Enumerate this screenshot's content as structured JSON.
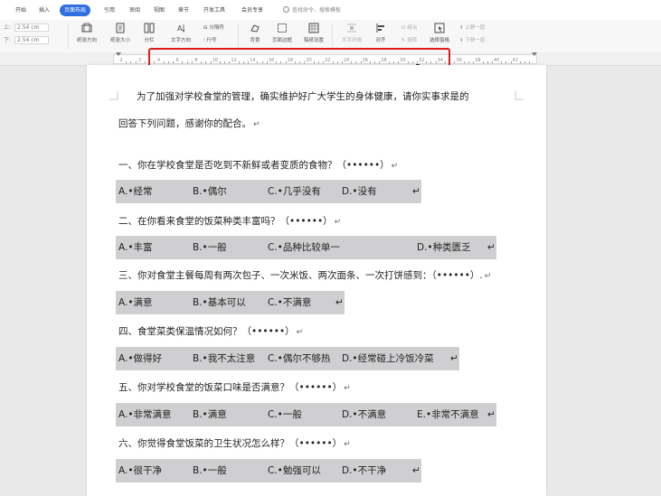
{
  "tabs": {
    "start": "开始",
    "insert": "插入",
    "page_layout": "页面布局",
    "references": "引用",
    "review": "审阅",
    "view": "视图",
    "sections": "章节",
    "developer": "开发工具",
    "member": "会员专享",
    "search_placeholder": "查找命令、搜索模板"
  },
  "ribbon": {
    "margin_top_label": "上:",
    "margin_top_value": "2.54 cm",
    "margin_bottom_label": "下:",
    "margin_bottom_value": "2.54 cm",
    "margin_left_label": "左:",
    "margin_left_value": "3.18 cm",
    "margin_right_label": "右:",
    "margin_right_value": "3.18 cm",
    "orientation": "纸张方向",
    "size": "纸张大小",
    "columns": "分栏",
    "text_direction": "文字方向",
    "line_numbers": "行号",
    "breaks": "分隔符",
    "background": "背景",
    "page_border": "页面边框",
    "draft_paper": "稿纸设置",
    "text_wrap": "文字环绕",
    "align": "对齐",
    "rotate": "旋转",
    "group": "组合",
    "selection_pane": "选择窗格",
    "bring_forward": "上移一层",
    "send_backward": "下移一层"
  },
  "ruler": {
    "numbers": [
      "2",
      "2",
      "4",
      "6",
      "8",
      "10",
      "12",
      "14",
      "16",
      "18",
      "20",
      "22",
      "24",
      "26",
      "28",
      "30",
      "32",
      "34",
      "36",
      "38",
      "40",
      "42"
    ]
  },
  "document": {
    "intro_line1": "为了加强对学校食堂的管理，确实维护好广大学生的身体健康，请你实事求是的",
    "intro_line2": "回答下列问题，感谢你的配合。",
    "paragraph_mark": "↵",
    "questions": [
      {
        "text": "一、你在学校食堂是否吃到不新鲜或者变质的食物？（••••••）",
        "options": [
          "A.•经常",
          "B.•偶尔",
          "C.•几乎没有",
          "D.•没有"
        ]
      },
      {
        "text": "二、在你看来食堂的饭菜种类丰富吗？（••••••）",
        "options": [
          "A.•丰富",
          "B.•一般",
          "C.•品种比较单一",
          "D.•种类匮乏"
        ]
      },
      {
        "text": "三、你对食堂主餐每周有两次包子、一次米饭、两次面条、一次打饼感到：（••••••）.",
        "options": [
          "A.•满意",
          "B.•基本可以",
          "C.•不满意"
        ]
      },
      {
        "text": "四、食堂菜类保温情况如何？（••••••）",
        "options": [
          "A.•做得好",
          "B.•我不太注意",
          "C.•偶尔不够热",
          "D.•经常碰上冷饭冷菜"
        ]
      },
      {
        "text": "五、你对学校食堂的饭菜口味是否满意？（••••••）",
        "options": [
          "A.•非常满意",
          "B.•满意",
          "C.•一般",
          "D.•不满意",
          "E.•非常不满意"
        ]
      },
      {
        "text": "六、你觉得食堂饭菜的卫生状况怎么样？（••••••）",
        "options": [
          "A.•很干净",
          "B.•一般",
          "C.•勉强可以",
          "D.•不干净"
        ]
      }
    ]
  }
}
